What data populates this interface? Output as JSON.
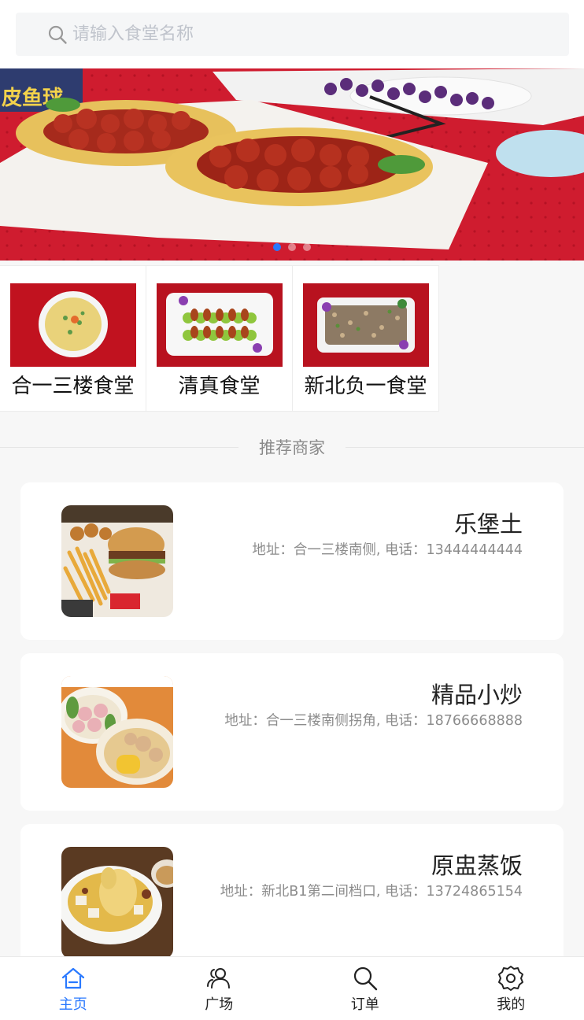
{
  "search": {
    "placeholder": "请输入食堂名称",
    "icon": "search-icon"
  },
  "banner": {
    "slides": 3,
    "active_index": 0,
    "accent": "#2979ff"
  },
  "canteens": [
    {
      "name": "合一三楼食堂"
    },
    {
      "name": "清真食堂"
    },
    {
      "name": "新北负一食堂"
    }
  ],
  "section": {
    "title": "推荐商家"
  },
  "merchants": [
    {
      "name": "乐堡土",
      "info": "地址：合一三楼南侧, 电话：13444444444"
    },
    {
      "name": "精品小炒",
      "info": "地址：合一三楼南侧拐角, 电话：18766668888"
    },
    {
      "name": "原盅蒸饭",
      "info": "地址：新北B1第二间档口, 电话：13724865154"
    }
  ],
  "tabbar": {
    "active": "home",
    "items": [
      {
        "key": "home",
        "label": "主页",
        "icon": "home-icon"
      },
      {
        "key": "square",
        "label": "广场",
        "icon": "users-icon"
      },
      {
        "key": "orders",
        "label": "订单",
        "icon": "search-icon"
      },
      {
        "key": "mine",
        "label": "我的",
        "icon": "gear-icon"
      }
    ]
  },
  "colors": {
    "accent": "#2979ff",
    "background": "#f7f7f7",
    "card": "#ffffff"
  }
}
